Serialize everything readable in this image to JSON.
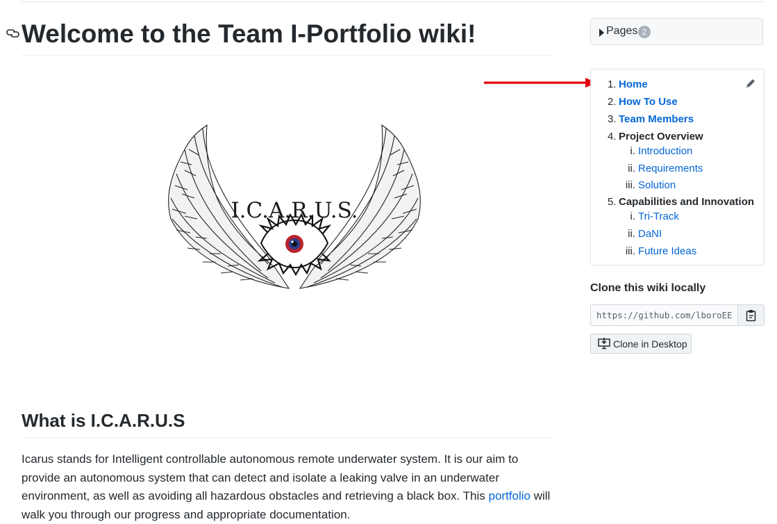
{
  "page": {
    "title": "Welcome to the Team I-Portfolio wiki!",
    "logo_text": "I.C.A.R.U.S."
  },
  "section": {
    "title": "What is I.C.A.R.U.S",
    "paragraph_before_link": "Icarus stands for Intelligent controllable autonomous remote underwater system. It is our aim to provide an autonomous system that can detect and isolate a leaking valve in an underwater environment, as well as avoiding all hazardous obstacles and retrieving a black box. This ",
    "link_text": "portfolio",
    "paragraph_after_link": " will walk you through our progress and appropriate documentation."
  },
  "sidebar": {
    "pages_label": "Pages",
    "pages_count": "2",
    "toc": [
      {
        "num": "1.",
        "label": "Home",
        "kind": "link"
      },
      {
        "num": "2.",
        "label": "How To Use",
        "kind": "link"
      },
      {
        "num": "3.",
        "label": "Team Members",
        "kind": "link"
      },
      {
        "num": "4.",
        "label": "Project Overview",
        "kind": "heading"
      },
      {
        "num": "i.",
        "label": "Introduction",
        "kind": "sublink"
      },
      {
        "num": "ii.",
        "label": "Requirements",
        "kind": "sublink"
      },
      {
        "num": "iii.",
        "label": "Solution",
        "kind": "sublink"
      },
      {
        "num": "5.",
        "label": "Capabilities and Innovation",
        "kind": "heading"
      },
      {
        "num": "i.",
        "label": "Tri-Track",
        "kind": "sublink"
      },
      {
        "num": "ii.",
        "label": "DaNI",
        "kind": "sublink"
      },
      {
        "num": "iii.",
        "label": "Future Ideas",
        "kind": "sublink"
      }
    ],
    "clone_title": "Clone this wiki locally",
    "clone_url": "https://github.com/lboroEES",
    "clone_desktop_label": "Clone in Desktop"
  },
  "colors": {
    "link": "#0366d6",
    "arrow": "#e3000f",
    "text": "#24292e"
  },
  "icons": [
    "link-icon",
    "caret-right-icon",
    "pencil-icon",
    "clipboard-icon",
    "desktop-download-icon",
    "arrow-annotation"
  ]
}
